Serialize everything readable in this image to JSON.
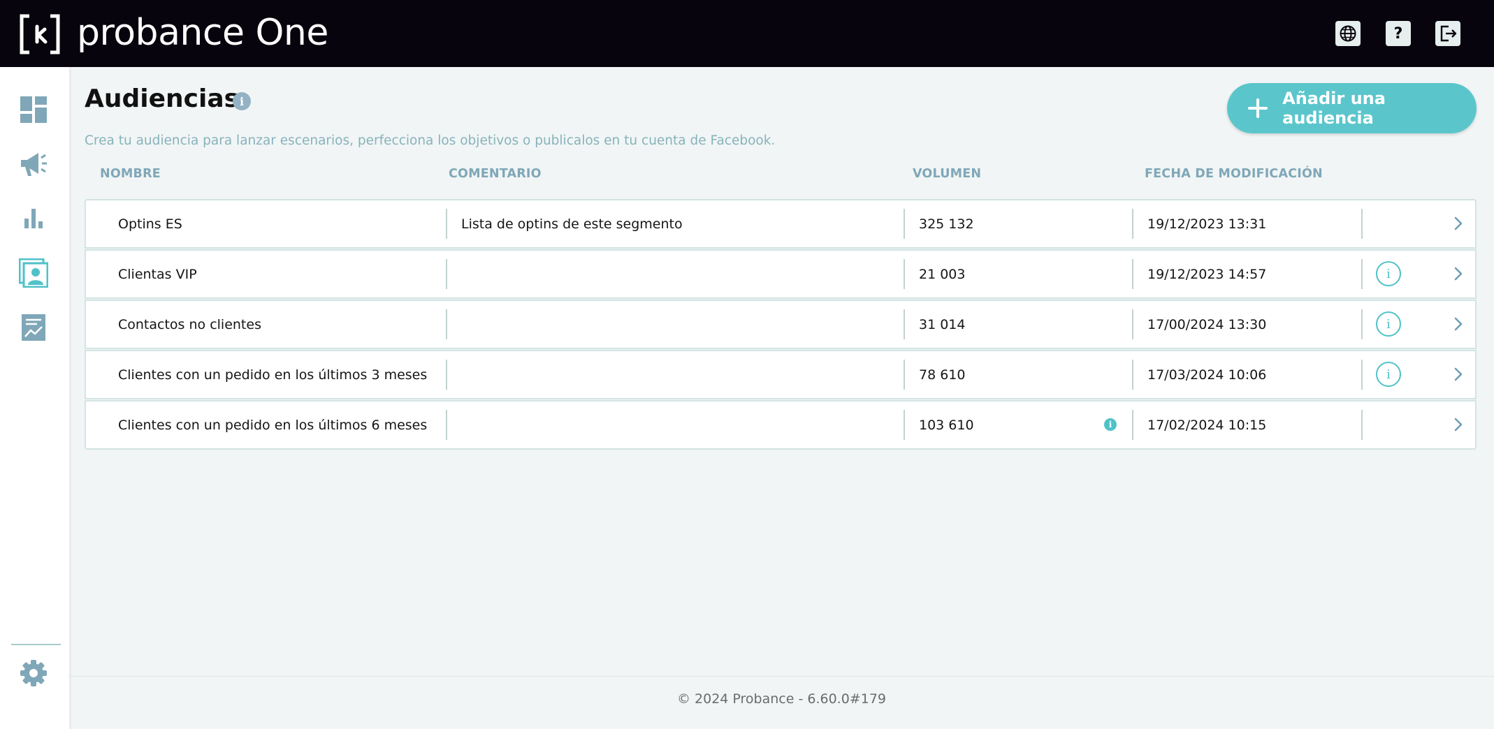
{
  "app": {
    "brand": "probance One",
    "colors": {
      "topbar": "#08040d",
      "accent": "#5ac6cc",
      "icon_muted": "#7fa7b8",
      "background": "#f1f5f5"
    }
  },
  "header": {
    "icons": [
      "globe-icon",
      "help-icon",
      "logout-icon"
    ],
    "help_label": "?"
  },
  "sidebar": {
    "items": [
      {
        "icon": "dashboard-icon"
      },
      {
        "icon": "megaphone-icon"
      },
      {
        "icon": "bar-chart-icon"
      },
      {
        "icon": "audience-icon",
        "active": true
      },
      {
        "icon": "report-icon"
      }
    ],
    "bottom_icon": "settings-icon"
  },
  "page": {
    "title": "Audiencias",
    "title_info": "i",
    "subtitle": "Crea tu audiencia para lanzar escenarios, perfecciona los objetivos o publicalos en tu cuenta de Facebook.",
    "add_button": "Añadir una audiencia"
  },
  "table": {
    "columns": [
      "NOMBRE",
      "COMENTARIO",
      "VOLUMEN",
      "FECHA DE MODIFICACIÓN"
    ],
    "rows": [
      {
        "name": "Optins ES",
        "comment": "Lista de optins de este segmento",
        "volume": "325 132",
        "date": "19/12/2023 13:31",
        "info": false,
        "volume_info": false
      },
      {
        "name": "Clientas VIP",
        "comment": "",
        "volume": "21 003",
        "date": "19/12/2023 14:57",
        "info": true,
        "volume_info": false
      },
      {
        "name": "Contactos no clientes",
        "comment": "",
        "volume": "31 014",
        "date": "17/00/2024 13:30",
        "info": true,
        "volume_info": false
      },
      {
        "name": "Clientes con un pedido en los últimos 3 meses",
        "comment": "",
        "volume": "78 610",
        "date": "17/03/2024 10:06",
        "info": true,
        "volume_info": false
      },
      {
        "name": "Clientes con un pedido en los últimos 6 meses",
        "comment": "",
        "volume": "103 610",
        "date": "17/02/2024 10:15",
        "info": false,
        "volume_info": true
      }
    ],
    "info_label": "i"
  },
  "footer": {
    "text": "© 2024 Probance - 6.60.0#179"
  }
}
